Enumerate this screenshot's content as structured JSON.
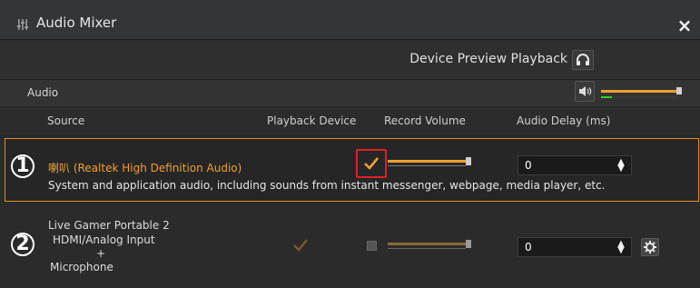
{
  "window": {
    "title": "Audio Mixer",
    "close_glyph": "×"
  },
  "preview": {
    "label": "Device Preview Playback",
    "icon": "headphones-icon"
  },
  "audio": {
    "label": "Audio",
    "icon": "speaker-icon",
    "master_level": 0.98
  },
  "headers": {
    "source": "Source",
    "playback_device": "Playback Device",
    "record_volume": "Record Volume",
    "audio_delay": "Audio Delay (ms)"
  },
  "rows": [
    {
      "number": "1",
      "name": "喇叭 (Realtek High Definition Audio)",
      "description": "System and application audio, including sounds from instant messenger, webpage, media player, etc.",
      "playback_checked": true,
      "record_volume": 0.9,
      "delay": "0",
      "highlight_color": "#d8931f"
    },
    {
      "number": "2",
      "name_line1": "Live Gamer Portable 2",
      "name_line2": "HDMI/Analog Input",
      "name_plus": "+",
      "name_line3": "Microphone",
      "playback_checked": true,
      "record_checked": false,
      "record_volume": 0.9,
      "delay": "0"
    }
  ],
  "colors": {
    "accent": "#f0a030",
    "meter_green": "#2bd12b",
    "selection_red": "#d22222"
  }
}
